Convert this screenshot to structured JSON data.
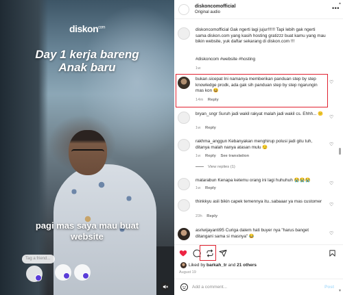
{
  "video": {
    "brand_name": "diskon",
    "brand_suffix": "com",
    "headline_line1": "Day 1 kerja bareng",
    "headline_line2": "Anak baru",
    "subtitle_line1": "pagi mas saya mau buat",
    "subtitle_line2": "website",
    "tag_placeholder": "Tag a friend...",
    "mute_icon": "speaker-muted-icon"
  },
  "post": {
    "username": "diskoncomofficial",
    "audio": "Original audio",
    "more_icon": "more-options-icon"
  },
  "comments": [
    {
      "user": "diskoncomofficial",
      "text": "Gak ngerti lagi jujur!!!!!! Tapi lebih gak ngerti sama diskon.com yang kasih hosting gratizzz buat kamu yang mau bikin website, yuk daftar sekarang di diskon.com !!!",
      "hashtags": "#diskoncom #website #hosting",
      "time": "1w",
      "reply": ""
    },
    {
      "user": "bukan.sicepat",
      "text": "Ini namanya memberikan panduan step by step knowledge prodk, ada gak sih panduan step by step ngarungin mas kon 😆",
      "time": "14m",
      "reply": "Reply"
    },
    {
      "user": "bryan_sngr",
      "text": "Suruh jadi wakil rakyat malah jadi wakil cs. Ehhh... 😕",
      "time": "1w",
      "reply": "Reply"
    },
    {
      "user": "rakhma_anggun",
      "text": "Kebanyakan menghirup polusi jadi gitu tuh, ditanya malah nanya atasan mulu 😏",
      "time": "1w",
      "reply": "Reply",
      "translation": "See translation",
      "view_replies": "View replies (1)"
    },
    {
      "user": "matarabun",
      "text": "Kenapa ketemu orang ini lagi huhuhuh 😭😭😭",
      "time": "1w",
      "reply": "Reply"
    },
    {
      "user": "thinkkyu",
      "text": "asli bikin capek temennya itu..sabaaar ya mas customer",
      "time": "23h",
      "reply": "Reply"
    },
    {
      "user": "asriwijayanti95",
      "text": "Curiga dalem hati buyer nya \"harus banget ditangani sama si masnya\" 😂",
      "time": "",
      "reply": ""
    }
  ],
  "actions": {
    "like_icon": "heart-icon",
    "comment_icon": "comment-icon",
    "share_icon": "repost-icon",
    "send_icon": "send-icon",
    "save_icon": "bookmark-icon",
    "liked_by_prefix": "Liked by",
    "liked_by_user": "barkah_tr",
    "liked_by_and": "and",
    "liked_by_others": "21 others",
    "date": "August 19"
  },
  "add_comment": {
    "placeholder": "Add a comment...",
    "post_label": "Post",
    "emoji_icon": "emoji-icon"
  },
  "colors": {
    "accent_red": "#ed2443",
    "highlight_border": "#e0202f",
    "post_button": "#b2dffc"
  }
}
